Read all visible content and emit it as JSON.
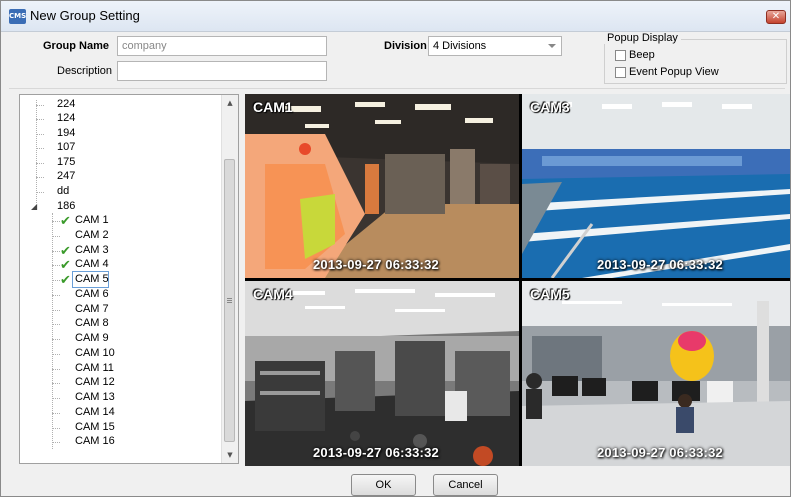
{
  "window": {
    "title": "New Group Setting",
    "app_icon": "CMS",
    "close_glyph": "✕"
  },
  "form": {
    "group_name_label": "Group Name",
    "group_name_value": "company",
    "description_label": "Description",
    "description_value": "",
    "division_label": "Division",
    "division_value": "4 Divisions"
  },
  "popup_display": {
    "title": "Popup Display",
    "options": [
      {
        "label": "Beep",
        "checked": false
      },
      {
        "label": "Event Popup View",
        "checked": false
      }
    ]
  },
  "tree": {
    "top_items": [
      "224",
      "124",
      "194",
      "107",
      "175",
      "247",
      "dd"
    ],
    "expanded_group": "186",
    "cameras": [
      {
        "label": "CAM 1",
        "checked": true
      },
      {
        "label": "CAM 2",
        "checked": false
      },
      {
        "label": "CAM 3",
        "checked": true
      },
      {
        "label": "CAM 4",
        "checked": true
      },
      {
        "label": "CAM 5",
        "checked": true,
        "selected": true
      },
      {
        "label": "CAM 6",
        "checked": false
      },
      {
        "label": "CAM 7",
        "checked": false
      },
      {
        "label": "CAM 8",
        "checked": false
      },
      {
        "label": "CAM 9",
        "checked": false
      },
      {
        "label": "CAM 10",
        "checked": false
      },
      {
        "label": "CAM 11",
        "checked": false
      },
      {
        "label": "CAM 12",
        "checked": false
      },
      {
        "label": "CAM 13",
        "checked": false
      },
      {
        "label": "CAM 14",
        "checked": false
      },
      {
        "label": "CAM 15",
        "checked": false
      },
      {
        "label": "CAM 16",
        "checked": false
      }
    ]
  },
  "views": [
    {
      "label": "CAM1",
      "timestamp": "2013-09-27  06:33:32",
      "scene": "lobby"
    },
    {
      "label": "CAM3",
      "timestamp": "2013-09-27  06:33:32",
      "scene": "pool"
    },
    {
      "label": "CAM4",
      "timestamp": "2013-09-27  06:33:32",
      "scene": "gym"
    },
    {
      "label": "CAM5",
      "timestamp": "2013-09-27  06:33:32",
      "scene": "office"
    }
  ],
  "buttons": {
    "ok": "OK",
    "cancel": "Cancel"
  },
  "colors": {
    "checkmark": "#3a9a2a",
    "title_bar": "#dde6f2",
    "close_button": "#c4432f"
  }
}
